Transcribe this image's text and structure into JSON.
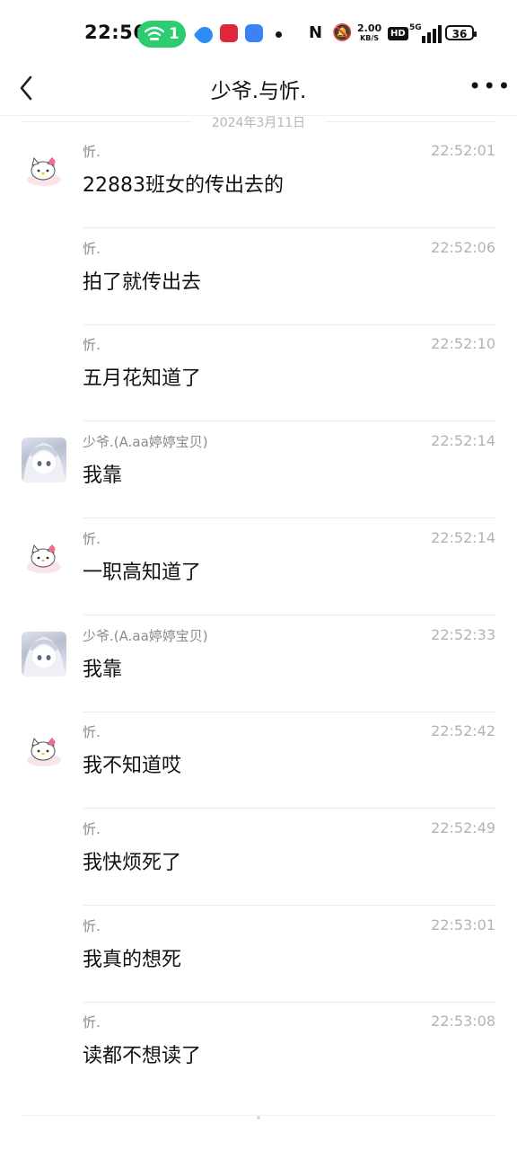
{
  "status_bar": {
    "time": "22:56",
    "wifi_count": "1",
    "net_speed_value": "2.00",
    "net_speed_unit": "KB/S",
    "hd": "HD",
    "network_type": "5G",
    "battery": "36"
  },
  "header": {
    "title": "少爷.与忻.",
    "more_label": "•••"
  },
  "date_separator": "2024年3月11日",
  "messages": [
    {
      "sender": "忻.",
      "time": "22:52:01",
      "text": "22883班女的传出去的",
      "avatar": "hello-kitty-avatar"
    },
    {
      "sender": "忻.",
      "time": "22:52:06",
      "text": "拍了就传出去",
      "avatar": ""
    },
    {
      "sender": "忻.",
      "time": "22:52:10",
      "text": "五月花知道了",
      "avatar": ""
    },
    {
      "sender": "少爷.(A.aa婷婷宝贝)",
      "time": "22:52:14",
      "text": "我靠",
      "avatar": "anime-girl-avatar"
    },
    {
      "sender": "忻.",
      "time": "22:52:14",
      "text": "一职高知道了",
      "avatar": "hello-kitty-avatar"
    },
    {
      "sender": "少爷.(A.aa婷婷宝贝)",
      "time": "22:52:33",
      "text": "我靠",
      "avatar": "anime-girl-avatar"
    },
    {
      "sender": "忻.",
      "time": "22:52:42",
      "text": "我不知道哎",
      "avatar": "hello-kitty-avatar"
    },
    {
      "sender": "忻.",
      "time": "22:52:49",
      "text": "我快烦死了",
      "avatar": ""
    },
    {
      "sender": "忻.",
      "time": "22:53:01",
      "text": "我真的想死",
      "avatar": ""
    },
    {
      "sender": "忻.",
      "time": "22:53:08",
      "text": "读都不想读了",
      "avatar": ""
    }
  ]
}
